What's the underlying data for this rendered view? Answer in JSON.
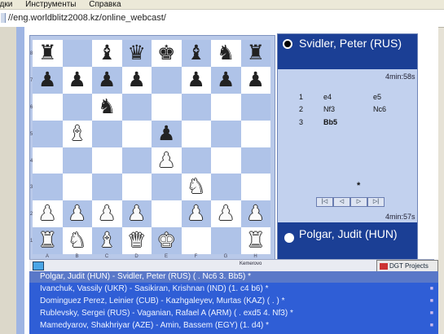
{
  "menu": {
    "items": [
      "адки",
      "Инструменты",
      "Справка"
    ]
  },
  "address": {
    "url": "//eng.worldblitz2008.kz/online_webcast/"
  },
  "board": {
    "ranks": [
      "8",
      "7",
      "6",
      "5",
      "4",
      "3",
      "2",
      "1"
    ],
    "files": [
      "A",
      "B",
      "C",
      "D",
      "E",
      "F",
      "G",
      "H"
    ],
    "position": [
      [
        "bR",
        "",
        "bB",
        "bQ",
        "bK",
        "bB",
        "bN",
        "bR"
      ],
      [
        "bP",
        "bP",
        "bP",
        "bP",
        "",
        "bP",
        "bP",
        "bP"
      ],
      [
        "",
        "",
        "bN",
        "",
        "",
        "",
        "",
        ""
      ],
      [
        "",
        "wB",
        "",
        "",
        "bP",
        "",
        "",
        ""
      ],
      [
        "",
        "",
        "",
        "",
        "wP",
        "",
        "",
        ""
      ],
      [
        "",
        "",
        "",
        "",
        "",
        "wN",
        "",
        ""
      ],
      [
        "wP",
        "wP",
        "wP",
        "wP",
        "",
        "wP",
        "wP",
        "wP"
      ],
      [
        "wR",
        "wN",
        "wB",
        "wQ",
        "wK",
        "",
        "",
        "wR"
      ]
    ]
  },
  "players": {
    "black": {
      "name": "Svidler, Peter (RUS)",
      "clock": "4min:58s"
    },
    "white": {
      "name": "Polgar, Judit (HUN)",
      "clock": "4min:57s"
    }
  },
  "moves": [
    {
      "num": "1",
      "white": "e4",
      "black": "e5"
    },
    {
      "num": "2",
      "white": "Nf3",
      "black": "Nc6"
    },
    {
      "num": "3",
      "white": "Bb5",
      "black": ""
    }
  ],
  "move_marker": "*",
  "nav": [
    "|◁",
    "◁",
    "▷",
    "▷|"
  ],
  "status": {
    "venue": "Kemerovo"
  },
  "dgt": {
    "label": "DGT Projects"
  },
  "games": [
    "Polgar, Judit (HUN) - Svidler, Peter (RUS) ( . Nc6 3. Bb5) *",
    "Ivanchuk, Vassily (UKR) - Sasikiran, Krishnan (IND) (1. c4 b6) *",
    "Dominguez Perez, Leinier (CUB) - Kazhgaleyev, Murtas (KAZ) ( . ) *",
    "Rublevsky, Sergei (RUS) - Vaganian, Rafael A (ARM) ( . exd5 4. Nf3) *",
    "Mamedyarov, Shakhriyar (AZE) - Amin, Bassem (EGY) (1. d4) *"
  ]
}
